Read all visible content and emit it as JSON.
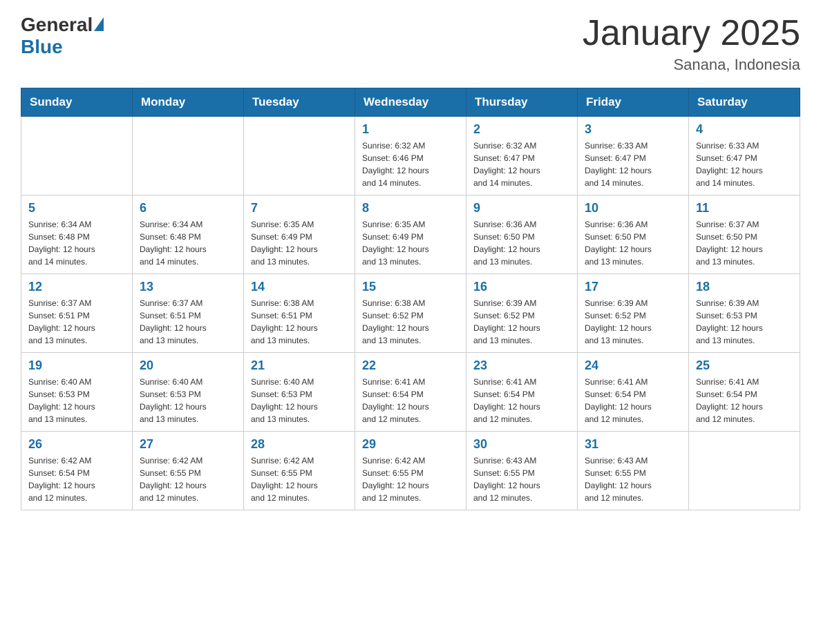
{
  "logo": {
    "general": "General",
    "blue": "Blue"
  },
  "title": "January 2025",
  "location": "Sanana, Indonesia",
  "days_header": [
    "Sunday",
    "Monday",
    "Tuesday",
    "Wednesday",
    "Thursday",
    "Friday",
    "Saturday"
  ],
  "weeks": [
    [
      {
        "day": "",
        "info": ""
      },
      {
        "day": "",
        "info": ""
      },
      {
        "day": "",
        "info": ""
      },
      {
        "day": "1",
        "info": "Sunrise: 6:32 AM\nSunset: 6:46 PM\nDaylight: 12 hours\nand 14 minutes."
      },
      {
        "day": "2",
        "info": "Sunrise: 6:32 AM\nSunset: 6:47 PM\nDaylight: 12 hours\nand 14 minutes."
      },
      {
        "day": "3",
        "info": "Sunrise: 6:33 AM\nSunset: 6:47 PM\nDaylight: 12 hours\nand 14 minutes."
      },
      {
        "day": "4",
        "info": "Sunrise: 6:33 AM\nSunset: 6:47 PM\nDaylight: 12 hours\nand 14 minutes."
      }
    ],
    [
      {
        "day": "5",
        "info": "Sunrise: 6:34 AM\nSunset: 6:48 PM\nDaylight: 12 hours\nand 14 minutes."
      },
      {
        "day": "6",
        "info": "Sunrise: 6:34 AM\nSunset: 6:48 PM\nDaylight: 12 hours\nand 14 minutes."
      },
      {
        "day": "7",
        "info": "Sunrise: 6:35 AM\nSunset: 6:49 PM\nDaylight: 12 hours\nand 13 minutes."
      },
      {
        "day": "8",
        "info": "Sunrise: 6:35 AM\nSunset: 6:49 PM\nDaylight: 12 hours\nand 13 minutes."
      },
      {
        "day": "9",
        "info": "Sunrise: 6:36 AM\nSunset: 6:50 PM\nDaylight: 12 hours\nand 13 minutes."
      },
      {
        "day": "10",
        "info": "Sunrise: 6:36 AM\nSunset: 6:50 PM\nDaylight: 12 hours\nand 13 minutes."
      },
      {
        "day": "11",
        "info": "Sunrise: 6:37 AM\nSunset: 6:50 PM\nDaylight: 12 hours\nand 13 minutes."
      }
    ],
    [
      {
        "day": "12",
        "info": "Sunrise: 6:37 AM\nSunset: 6:51 PM\nDaylight: 12 hours\nand 13 minutes."
      },
      {
        "day": "13",
        "info": "Sunrise: 6:37 AM\nSunset: 6:51 PM\nDaylight: 12 hours\nand 13 minutes."
      },
      {
        "day": "14",
        "info": "Sunrise: 6:38 AM\nSunset: 6:51 PM\nDaylight: 12 hours\nand 13 minutes."
      },
      {
        "day": "15",
        "info": "Sunrise: 6:38 AM\nSunset: 6:52 PM\nDaylight: 12 hours\nand 13 minutes."
      },
      {
        "day": "16",
        "info": "Sunrise: 6:39 AM\nSunset: 6:52 PM\nDaylight: 12 hours\nand 13 minutes."
      },
      {
        "day": "17",
        "info": "Sunrise: 6:39 AM\nSunset: 6:52 PM\nDaylight: 12 hours\nand 13 minutes."
      },
      {
        "day": "18",
        "info": "Sunrise: 6:39 AM\nSunset: 6:53 PM\nDaylight: 12 hours\nand 13 minutes."
      }
    ],
    [
      {
        "day": "19",
        "info": "Sunrise: 6:40 AM\nSunset: 6:53 PM\nDaylight: 12 hours\nand 13 minutes."
      },
      {
        "day": "20",
        "info": "Sunrise: 6:40 AM\nSunset: 6:53 PM\nDaylight: 12 hours\nand 13 minutes."
      },
      {
        "day": "21",
        "info": "Sunrise: 6:40 AM\nSunset: 6:53 PM\nDaylight: 12 hours\nand 13 minutes."
      },
      {
        "day": "22",
        "info": "Sunrise: 6:41 AM\nSunset: 6:54 PM\nDaylight: 12 hours\nand 12 minutes."
      },
      {
        "day": "23",
        "info": "Sunrise: 6:41 AM\nSunset: 6:54 PM\nDaylight: 12 hours\nand 12 minutes."
      },
      {
        "day": "24",
        "info": "Sunrise: 6:41 AM\nSunset: 6:54 PM\nDaylight: 12 hours\nand 12 minutes."
      },
      {
        "day": "25",
        "info": "Sunrise: 6:41 AM\nSunset: 6:54 PM\nDaylight: 12 hours\nand 12 minutes."
      }
    ],
    [
      {
        "day": "26",
        "info": "Sunrise: 6:42 AM\nSunset: 6:54 PM\nDaylight: 12 hours\nand 12 minutes."
      },
      {
        "day": "27",
        "info": "Sunrise: 6:42 AM\nSunset: 6:55 PM\nDaylight: 12 hours\nand 12 minutes."
      },
      {
        "day": "28",
        "info": "Sunrise: 6:42 AM\nSunset: 6:55 PM\nDaylight: 12 hours\nand 12 minutes."
      },
      {
        "day": "29",
        "info": "Sunrise: 6:42 AM\nSunset: 6:55 PM\nDaylight: 12 hours\nand 12 minutes."
      },
      {
        "day": "30",
        "info": "Sunrise: 6:43 AM\nSunset: 6:55 PM\nDaylight: 12 hours\nand 12 minutes."
      },
      {
        "day": "31",
        "info": "Sunrise: 6:43 AM\nSunset: 6:55 PM\nDaylight: 12 hours\nand 12 minutes."
      },
      {
        "day": "",
        "info": ""
      }
    ]
  ]
}
